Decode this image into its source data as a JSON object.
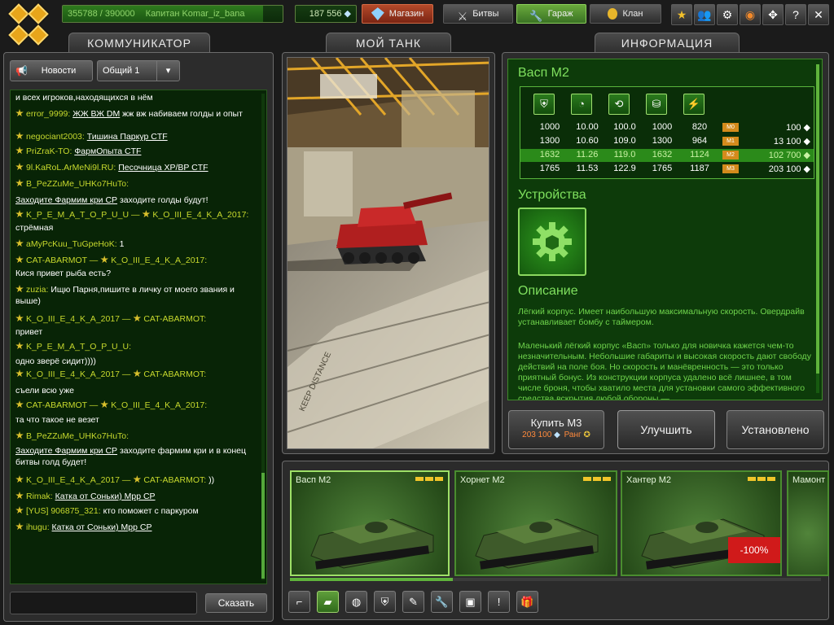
{
  "topbar": {
    "xp_text": "355788 / 390000",
    "xp_fraction": 0.912,
    "rank_name": "Капитан Komar_iz_bana",
    "crystals": "187 556",
    "shop_label": "Магазин",
    "battles_label": "Битвы",
    "garage_label": "Гараж",
    "clan_label": "Клан"
  },
  "tabs": {
    "communicator": "КОММУНИКАТОР",
    "my_tank": "МОЙ ТАНК",
    "info": "ИНФОРМАЦИЯ"
  },
  "chat": {
    "news_label": "Новости",
    "channel": "Общий 1",
    "send_label": "Сказать",
    "input_placeholder": "",
    "messages": [
      {
        "text": "и всех игроков,находящихся в нём"
      },
      {
        "user": "error_9999:",
        "u": "ЖЖ ВЖ DM",
        "rest": " жж вж набиваем голды и опыт"
      },
      {
        "user": "negociant2003:",
        "u": "Тишина Паркур CTF"
      },
      {
        "user": "PriZraK-TO:",
        "u": "ФармОпыта CTF"
      },
      {
        "user": "9l.KaRoL.ArMeNi9l.RU:",
        "u": "Песочница XP/BP CTF"
      },
      {
        "user": "B_PeZZuMe_UHKo7HuTo:"
      },
      {
        "u": "Заходите Фармим кри СР",
        "rest": " заходите голды будут!"
      },
      {
        "user": "K_P_E_M_A_T_O_P_U_U — ",
        "user2": "K_O_III_E_4_K_A_2017:"
      },
      {
        "text": "стрёмная"
      },
      {
        "user": "aMyPcKuu_TuGpeHoK:",
        "rest": " 1"
      },
      {
        "user": "CAT-ABARMOT — ",
        "user2": "K_O_III_E_4_K_A_2017:"
      },
      {
        "text": "Кися привет рыба есть?"
      },
      {
        "user": "zuzia:",
        "rest": " Ищю Парня,пишите в личку от моего звания и выше)"
      },
      {
        "user": "K_O_III_E_4_K_A_2017 — ",
        "user2": "CAT-ABARMOT:"
      },
      {
        "text": "привет"
      },
      {
        "user": "K_P_E_M_A_T_O_P_U_U:"
      },
      {
        "text": "одно зверё сидит))))"
      },
      {
        "user": "K_O_III_E_4_K_A_2017 — ",
        "user2": "CAT-ABARMOT:"
      },
      {
        "text": "съели всю уже"
      },
      {
        "user": "CAT-ABARMOT — ",
        "user2": "K_O_III_E_4_K_A_2017:"
      },
      {
        "text": "та что такое не везет"
      },
      {
        "user": "B_PeZZuMe_UHKo7HuTo:"
      },
      {
        "u": "Заходите Фармим кри СР",
        "rest": " заходите фармим кри и в конец битвы голд будет!"
      },
      {
        "user": "K_O_III_E_4_K_A_2017 — ",
        "user2": "CAT-ABARMOT:",
        "rest": " ))"
      },
      {
        "user": "Rimak:",
        "u": "Катка от Соньки) Мрр СР"
      },
      {
        "user": "[YUS] 906875_321:",
        "rest": " кто поможет с паркуром"
      },
      {
        "user": "ihugu:",
        "u": "Катка от Соньки) Мрр СР"
      }
    ]
  },
  "info": {
    "title": "Васп М2",
    "stats_rows": [
      [
        "1000",
        "10.00",
        "100.0",
        "1000",
        "820",
        "M0",
        "100"
      ],
      [
        "1300",
        "10.60",
        "109.0",
        "1300",
        "964",
        "M1",
        "13 100"
      ],
      [
        "1632",
        "11.26",
        "119.0",
        "1632",
        "1124",
        "M2",
        "102 700"
      ],
      [
        "1765",
        "11.53",
        "122.9",
        "1765",
        "1187",
        "M3",
        "203 100"
      ]
    ],
    "devices_title": "Устройства",
    "desc_title": "Описание",
    "desc1": "Лёгкий корпус. Имеет наибольшую максимальную скорость. Овердрайв устанавливает бомбу с таймером.",
    "desc2": "Маленький лёгкий корпус «Васп» только для новичка кажется чем-то незначительным. Небольшие габариты и высокая скорость дают свободу действий на поле боя. Но скорость и манёвренность — это только приятный бонус. Из конструкции корпуса удалено всё лишнее, в том числе броня, чтобы хватило места для установки самого эффективного средства вскрытия любой обороны —",
    "buy_label": "Купить М3",
    "buy_price": "203 100",
    "buy_rank": "Ранг",
    "upgrade_label": "Улучшить",
    "installed_label": "Установлено"
  },
  "hulls": [
    {
      "name": "Васп М2"
    },
    {
      "name": "Хорнет М2"
    },
    {
      "name": "Хантер М2",
      "discount": "-100%"
    },
    {
      "name": "Мамонт"
    }
  ],
  "garage_scene": {
    "sign_text": "KEEP DISTANCE"
  },
  "colors": {
    "accent": "#4fae32",
    "panel_green": "#0d3b0a",
    "gold": "#f0c52a"
  }
}
